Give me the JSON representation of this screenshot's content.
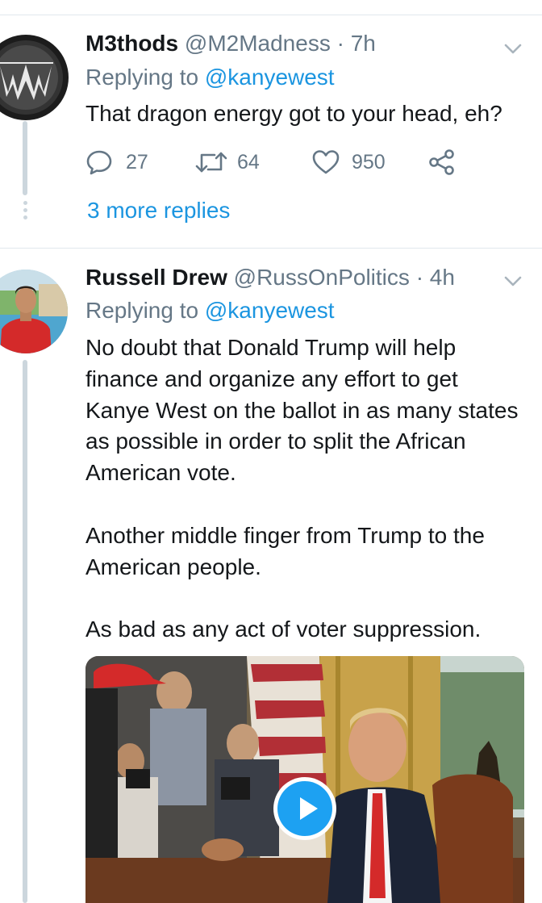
{
  "tweets": [
    {
      "name": "M3thods",
      "handle": "@M2Madness",
      "time": "· 7h",
      "replying_prefix": "Replying to",
      "replying_to": "@kanyewest",
      "text": [
        "That dragon energy got to your head, eh?"
      ],
      "replies": "27",
      "retweets": "64",
      "likes": "950",
      "more_replies": "3 more replies"
    },
    {
      "name": "Russell Drew",
      "handle": "@RussOnPolitics",
      "time": "· 4h",
      "replying_prefix": "Replying to",
      "replying_to": "@kanyewest",
      "text": [
        "No doubt that Donald Trump will help finance and organize any effort to get Kanye West on the ballot in as many states as possible in order to split the African American vote.",
        "Another middle finger from Trump to the American people.",
        "As bad as any act of voter suppression."
      ]
    }
  ],
  "colors": {
    "link": "#1b95e0",
    "secondary_text": "#657786",
    "thread_line": "#ccd6dd",
    "play_button": "#1da1f2"
  },
  "icons": [
    "avatar-m3thods-logo",
    "avatar-russell-photo",
    "chevron-down-icon",
    "reply-icon",
    "retweet-icon",
    "like-icon",
    "share-icon",
    "play-icon"
  ]
}
